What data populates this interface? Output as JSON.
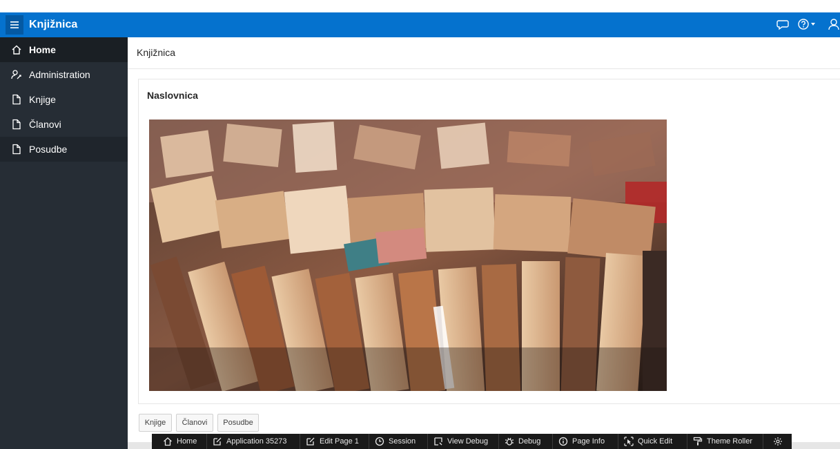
{
  "header": {
    "app_title": "Knjižnica"
  },
  "sidebar": {
    "items": [
      {
        "label": "Home"
      },
      {
        "label": "Administration"
      },
      {
        "label": "Knjige"
      },
      {
        "label": "Članovi"
      },
      {
        "label": "Posudbe"
      }
    ]
  },
  "main": {
    "page_title": "Knjižnica",
    "region_title": "Naslovnica",
    "buttons": [
      {
        "label": "Knjige"
      },
      {
        "label": "Članovi"
      },
      {
        "label": "Posudbe"
      }
    ]
  },
  "devbar": {
    "items": [
      {
        "label": "Home"
      },
      {
        "label": "Application 35273"
      },
      {
        "label": "Edit Page 1"
      },
      {
        "label": "Session"
      },
      {
        "label": "View Debug"
      },
      {
        "label": "Debug"
      },
      {
        "label": "Page Info"
      },
      {
        "label": "Quick Edit"
      },
      {
        "label": "Theme Roller"
      }
    ]
  },
  "colors": {
    "header": "#0572ce",
    "sidebar": "#262d35",
    "devbar": "#1a1a1a"
  }
}
